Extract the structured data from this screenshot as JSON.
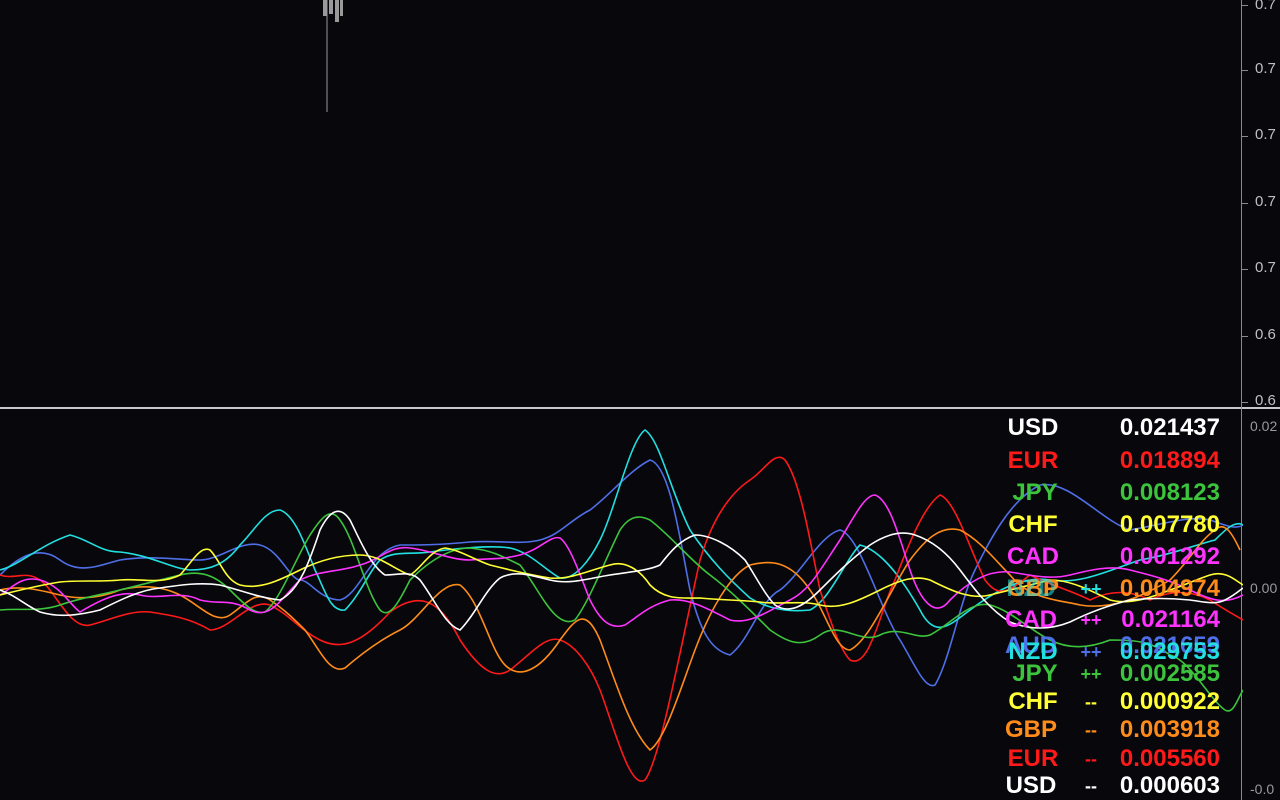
{
  "price_axis": {
    "labels": [
      "0.7",
      "0.7",
      "0.7",
      "0.7",
      "0.7",
      "0.6",
      "0.6"
    ]
  },
  "indicator_axis": {
    "top": "0.02",
    "zero": "0.00",
    "bottom": "-0.0"
  },
  "legend_strong": [
    {
      "name": "USD",
      "value": "0.021437",
      "color": "#ffffff",
      "mark": ""
    },
    {
      "name": "EUR",
      "value": "0.018894",
      "color": "#ff1a1a",
      "mark": ""
    },
    {
      "name": "JPY",
      "value": "0.008123",
      "color": "#3cc43c",
      "mark": ""
    },
    {
      "name": "CHF",
      "value": "0.007780",
      "color": "#ffff33",
      "mark": ""
    },
    {
      "name": "CAD",
      "value": "0.001292",
      "color": "#ff33ff",
      "mark": ""
    },
    {
      "name": "GBP",
      "value": "0.004974",
      "color": "#ff8c1a",
      "mark": ""
    },
    {
      "name": "NZD",
      "value": "",
      "color": "#22e0e0",
      "mark": "++"
    }
  ],
  "legend_weak": [
    {
      "name": "CAD",
      "value": "0.021164",
      "color": "#ff33ff",
      "mark": "++"
    },
    {
      "name": "AUD",
      "value": "0.021659",
      "color": "#4f6fe8",
      "mark": ""
    },
    {
      "name": "NZD",
      "value": "0.029753",
      "color": "#22e0e0",
      "mark": "++"
    },
    {
      "name": "JPY",
      "value": "0.002585",
      "color": "#3cc43c",
      "mark": "++"
    },
    {
      "name": "CHF",
      "value": "0.000922",
      "color": "#ffff33",
      "mark": "--"
    },
    {
      "name": "GBP",
      "value": "0.003918",
      "color": "#ff8c1a",
      "mark": "--"
    },
    {
      "name": "EUR",
      "value": "0.005560",
      "color": "#ff1a1a",
      "mark": "--"
    },
    {
      "name": "USD",
      "value": "0.000603",
      "color": "#ffffff",
      "mark": "--"
    }
  ],
  "series_colors": {
    "USD": "#ffffff",
    "EUR": "#ff1a1a",
    "JPY": "#3cc43c",
    "CHF": "#ffff33",
    "CAD": "#ff33ff",
    "GBP": "#ff8c1a",
    "NZD": "#22e0e0",
    "AUD": "#4f6fe8"
  }
}
